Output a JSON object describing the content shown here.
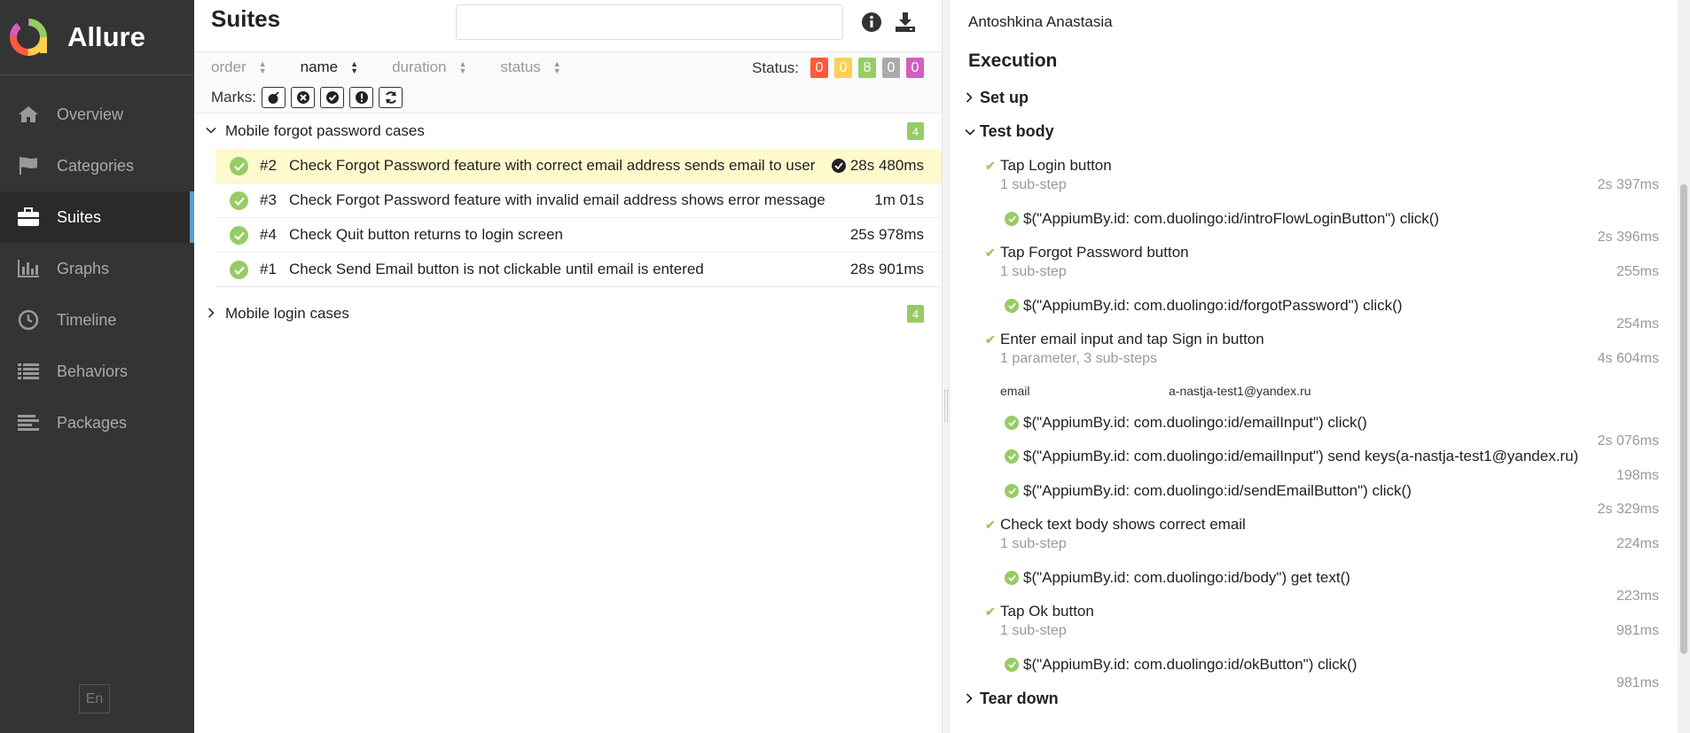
{
  "app": {
    "name": "Allure",
    "lang": "En"
  },
  "sidebar": {
    "items": [
      {
        "label": "Overview",
        "icon": "home-icon"
      },
      {
        "label": "Categories",
        "icon": "flag-icon"
      },
      {
        "label": "Suites",
        "icon": "briefcase-icon",
        "active": true
      },
      {
        "label": "Graphs",
        "icon": "bar-chart-icon"
      },
      {
        "label": "Timeline",
        "icon": "clock-icon"
      },
      {
        "label": "Behaviors",
        "icon": "list-icon"
      },
      {
        "label": "Packages",
        "icon": "align-left-icon"
      }
    ]
  },
  "suites": {
    "title": "Suites",
    "search_value": "",
    "sort": {
      "order": "order",
      "name": "name",
      "duration": "duration",
      "status": "status"
    },
    "status_label": "Status:",
    "status_counts": [
      {
        "value": "0",
        "color": "#fd5a3e"
      },
      {
        "value": "0",
        "color": "#ffd050"
      },
      {
        "value": "8",
        "color": "#97cc64"
      },
      {
        "value": "0",
        "color": "#aaaaaa"
      },
      {
        "value": "0",
        "color": "#d35ebe"
      }
    ],
    "marks_label": "Marks:",
    "groups": [
      {
        "name": "Mobile forgot password cases",
        "count": "4",
        "tests": [
          {
            "num": "#2",
            "name": "Check Forgot Password feature with correct email address sends email to user",
            "duration": "28s 480ms",
            "selected": true
          },
          {
            "num": "#3",
            "name": "Check Forgot Password feature with invalid email address shows error message",
            "duration": "1m 01s"
          },
          {
            "num": "#4",
            "name": "Check Quit button returns to login screen",
            "duration": "25s 978ms"
          },
          {
            "num": "#1",
            "name": "Check Send Email button is not clickable until email is entered",
            "duration": "28s 901ms"
          }
        ]
      },
      {
        "name": "Mobile login cases",
        "count": "4"
      }
    ]
  },
  "detail": {
    "owner": "Antoshkina Anastasia",
    "execution_title": "Execution",
    "setup": "Set up",
    "test_body": "Test body",
    "teardown": "Tear down",
    "steps": [
      {
        "name": "Tap Login button",
        "meta": "1 sub-step",
        "time": "2s 397ms",
        "sub": "$(\"AppiumBy.id: com.duolingo:id/introFlowLoginButton\") click()",
        "sub_time": "2s 396ms"
      },
      {
        "name": "Tap Forgot Password button",
        "meta": "1 sub-step",
        "time": "255ms",
        "sub": "$(\"AppiumBy.id: com.duolingo:id/forgotPassword\") click()",
        "sub_time": "254ms"
      },
      {
        "name": "Enter email input and tap Sign in button",
        "meta": "1 parameter, 3 sub-steps",
        "time": "4s 604ms",
        "param_name": "email",
        "param_value": "a-nastja-test1@yandex.ru",
        "subs": [
          {
            "text": "$(\"AppiumBy.id: com.duolingo:id/emailInput\") click()",
            "time": "2s 076ms"
          },
          {
            "text": "$(\"AppiumBy.id: com.duolingo:id/emailInput\") send keys(a-nastja-test1@yandex.ru)",
            "time": "198ms"
          },
          {
            "text": "$(\"AppiumBy.id: com.duolingo:id/sendEmailButton\") click()",
            "time": "2s 329ms"
          }
        ]
      },
      {
        "name": "Check text body shows correct email",
        "meta": "1 sub-step",
        "time": "224ms",
        "sub": "$(\"AppiumBy.id: com.duolingo:id/body\") get text()",
        "sub_time": "223ms"
      },
      {
        "name": "Tap Ok button",
        "meta": "1 sub-step",
        "time": "981ms",
        "sub": "$(\"AppiumBy.id: com.duolingo:id/okButton\") click()",
        "sub_time": "981ms"
      }
    ]
  }
}
